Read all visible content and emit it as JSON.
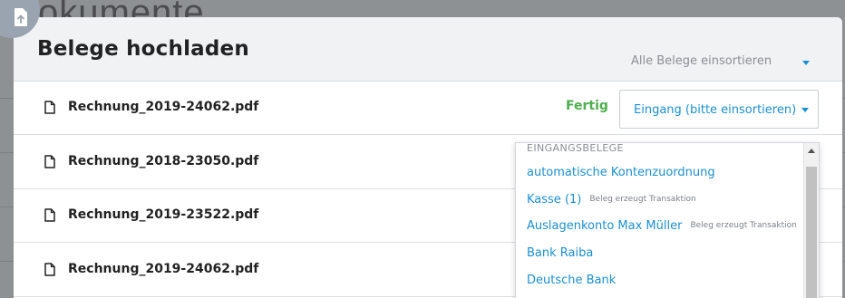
{
  "background": {
    "title_fragment": "okumente"
  },
  "upload_icon": "file-upload-icon",
  "modal": {
    "title": "Belege hochladen",
    "sort_all_label": "Alle Belege einsortieren"
  },
  "files": [
    {
      "name": "Rechnung_2019-24062.pdf",
      "status": "Fertig",
      "select_value": "Eingang (bitte einsortieren)"
    },
    {
      "name": "Rechnung_2018-23050.pdf",
      "status": "",
      "select_value": ""
    },
    {
      "name": "Rechnung_2019-23522.pdf",
      "status": "",
      "select_value": ""
    },
    {
      "name": "Rechnung_2019-24062.pdf",
      "status": "",
      "select_value": ""
    }
  ],
  "dropdown": {
    "group_label": "EINGANGSBELEGE",
    "items": [
      {
        "label": "automatische Kontenzuordnung",
        "note": ""
      },
      {
        "label": "Kasse (1)",
        "note": "Beleg erzeugt Transaktion"
      },
      {
        "label": "Auslagenkonto Max Müller",
        "note": "Beleg erzeugt Transaktion"
      },
      {
        "label": "Bank Raiba",
        "note": ""
      },
      {
        "label": "Deutsche Bank",
        "note": ""
      }
    ]
  },
  "colors": {
    "accent": "#1a8fd0",
    "success": "#4cae4c",
    "header_bg": "#f0f2f4"
  }
}
